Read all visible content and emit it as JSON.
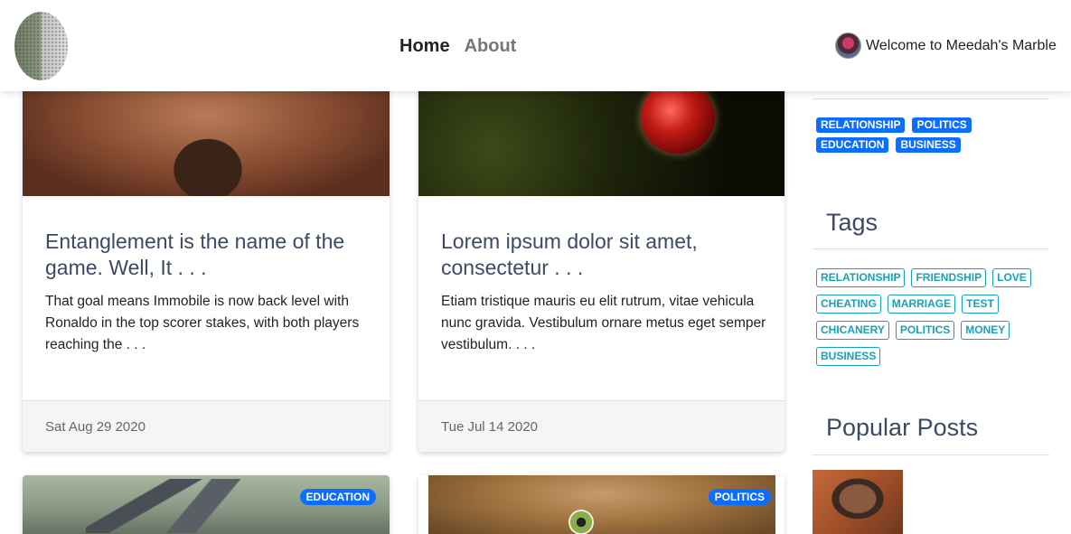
{
  "header": {
    "logo": "marble-logo",
    "nav": {
      "home": "Home",
      "about": "About"
    },
    "welcome": "Welcome to Meedah's Marble"
  },
  "posts": [
    {
      "title": "Entanglement is the name of the game. Well, It . . .",
      "excerpt": "That goal means Immobile is now back level with Ronaldo in the top scorer stakes, with both players reaching the . . .",
      "date": "Sat Aug 29 2020"
    },
    {
      "title": "Lorem ipsum dolor sit amet, consectetur . . .",
      "excerpt": "Etiam tristique mauris eu elit rutrum, vitae vehicula nunc gravida. Vestibulum ornare metus eget semper vestibulum. . . .",
      "date": "Tue Jul 14 2020"
    },
    {
      "badge": "EDUCATION"
    },
    {
      "badge": "POLITICS"
    }
  ],
  "sidebar": {
    "categories": [
      "RELATIONSHIP",
      "POLITICS",
      "EDUCATION",
      "BUSINESS"
    ],
    "tags_heading": "Tags",
    "tags": [
      "RELATIONSHIP",
      "FRIENDSHIP",
      "LOVE",
      "CHEATING",
      "MARRIAGE",
      "TEST",
      "CHICANERY",
      "POLITICS",
      "MONEY",
      "BUSINESS"
    ],
    "popular_heading": "Popular Posts"
  },
  "colors": {
    "primary": "#0d6efd",
    "info": "#17a2b8",
    "heading": "#3b4a66"
  }
}
